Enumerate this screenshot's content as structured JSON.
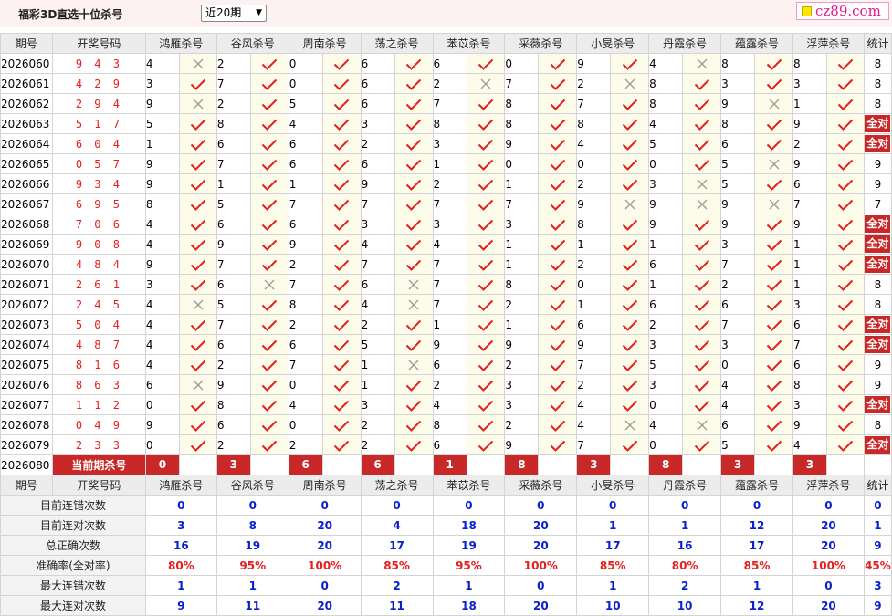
{
  "header": {
    "title": "福彩3D直选十位杀号",
    "range_selected": "近20期",
    "logo_text": "cz89.com"
  },
  "columns": {
    "issue": "期号",
    "code": "开奖号码",
    "experts": [
      "鸿雁杀号",
      "谷风杀号",
      "周南杀号",
      "荡之杀号",
      "苯苡杀号",
      "采薇杀号",
      "小旻杀号",
      "丹霞杀号",
      "蕴露杀号",
      "浮萍杀号"
    ],
    "stat": "统计"
  },
  "rows": [
    {
      "issue": "2026060",
      "code": "9 4 3",
      "kills": [
        4,
        2,
        0,
        6,
        6,
        0,
        9,
        4,
        8,
        8
      ],
      "hits": [
        0,
        1,
        1,
        1,
        1,
        1,
        1,
        0,
        1,
        1
      ],
      "stat": "8"
    },
    {
      "issue": "2026061",
      "code": "4 2 9",
      "kills": [
        3,
        7,
        0,
        6,
        2,
        7,
        2,
        8,
        3,
        3
      ],
      "hits": [
        1,
        1,
        1,
        1,
        0,
        1,
        0,
        1,
        1,
        1
      ],
      "stat": "8"
    },
    {
      "issue": "2026062",
      "code": "2 9 4",
      "kills": [
        9,
        2,
        5,
        6,
        7,
        8,
        7,
        8,
        9,
        1
      ],
      "hits": [
        0,
        1,
        1,
        1,
        1,
        1,
        1,
        1,
        0,
        1
      ],
      "stat": "8"
    },
    {
      "issue": "2026063",
      "code": "5 1 7",
      "kills": [
        5,
        8,
        4,
        3,
        8,
        8,
        8,
        4,
        8,
        9
      ],
      "hits": [
        1,
        1,
        1,
        1,
        1,
        1,
        1,
        1,
        1,
        1
      ],
      "stat": "全对"
    },
    {
      "issue": "2026064",
      "code": "6 0 4",
      "kills": [
        1,
        6,
        6,
        2,
        3,
        9,
        4,
        5,
        6,
        2
      ],
      "hits": [
        1,
        1,
        1,
        1,
        1,
        1,
        1,
        1,
        1,
        1
      ],
      "stat": "全对"
    },
    {
      "issue": "2026065",
      "code": "0 5 7",
      "kills": [
        9,
        7,
        6,
        6,
        1,
        0,
        0,
        0,
        5,
        9
      ],
      "hits": [
        1,
        1,
        1,
        1,
        1,
        1,
        1,
        1,
        0,
        1
      ],
      "stat": "9"
    },
    {
      "issue": "2026066",
      "code": "9 3 4",
      "kills": [
        9,
        1,
        1,
        9,
        2,
        1,
        2,
        3,
        5,
        6
      ],
      "hits": [
        1,
        1,
        1,
        1,
        1,
        1,
        1,
        0,
        1,
        1
      ],
      "stat": "9"
    },
    {
      "issue": "2026067",
      "code": "6 9 5",
      "kills": [
        8,
        5,
        7,
        7,
        7,
        7,
        9,
        9,
        9,
        7
      ],
      "hits": [
        1,
        1,
        1,
        1,
        1,
        1,
        0,
        0,
        0,
        1
      ],
      "stat": "7"
    },
    {
      "issue": "2026068",
      "code": "7 0 6",
      "kills": [
        4,
        6,
        6,
        3,
        3,
        3,
        8,
        9,
        9,
        9
      ],
      "hits": [
        1,
        1,
        1,
        1,
        1,
        1,
        1,
        1,
        1,
        1
      ],
      "stat": "全对"
    },
    {
      "issue": "2026069",
      "code": "9 0 8",
      "kills": [
        4,
        9,
        9,
        4,
        4,
        1,
        1,
        1,
        3,
        1
      ],
      "hits": [
        1,
        1,
        1,
        1,
        1,
        1,
        1,
        1,
        1,
        1
      ],
      "stat": "全对"
    },
    {
      "issue": "2026070",
      "code": "4 8 4",
      "kills": [
        9,
        7,
        2,
        7,
        7,
        1,
        2,
        6,
        7,
        1
      ],
      "hits": [
        1,
        1,
        1,
        1,
        1,
        1,
        1,
        1,
        1,
        1
      ],
      "stat": "全对"
    },
    {
      "issue": "2026071",
      "code": "2 6 1",
      "kills": [
        3,
        6,
        7,
        6,
        7,
        8,
        0,
        1,
        2,
        1
      ],
      "hits": [
        1,
        0,
        1,
        0,
        1,
        1,
        1,
        1,
        1,
        1
      ],
      "stat": "8"
    },
    {
      "issue": "2026072",
      "code": "2 4 5",
      "kills": [
        4,
        5,
        8,
        4,
        7,
        2,
        1,
        6,
        6,
        3
      ],
      "hits": [
        0,
        1,
        1,
        0,
        1,
        1,
        1,
        1,
        1,
        1
      ],
      "stat": "8"
    },
    {
      "issue": "2026073",
      "code": "5 0 4",
      "kills": [
        4,
        7,
        2,
        2,
        1,
        1,
        6,
        2,
        7,
        6
      ],
      "hits": [
        1,
        1,
        1,
        1,
        1,
        1,
        1,
        1,
        1,
        1
      ],
      "stat": "全对"
    },
    {
      "issue": "2026074",
      "code": "4 8 7",
      "kills": [
        4,
        6,
        6,
        5,
        9,
        9,
        9,
        3,
        3,
        7
      ],
      "hits": [
        1,
        1,
        1,
        1,
        1,
        1,
        1,
        1,
        1,
        1
      ],
      "stat": "全对"
    },
    {
      "issue": "2026075",
      "code": "8 1 6",
      "kills": [
        4,
        2,
        7,
        1,
        6,
        2,
        7,
        5,
        0,
        6
      ],
      "hits": [
        1,
        1,
        1,
        0,
        1,
        1,
        1,
        1,
        1,
        1
      ],
      "stat": "9"
    },
    {
      "issue": "2026076",
      "code": "8 6 3",
      "kills": [
        6,
        9,
        0,
        1,
        2,
        3,
        2,
        3,
        4,
        8
      ],
      "hits": [
        0,
        1,
        1,
        1,
        1,
        1,
        1,
        1,
        1,
        1
      ],
      "stat": "9"
    },
    {
      "issue": "2026077",
      "code": "1 1 2",
      "kills": [
        0,
        8,
        4,
        3,
        4,
        3,
        4,
        0,
        4,
        3
      ],
      "hits": [
        1,
        1,
        1,
        1,
        1,
        1,
        1,
        1,
        1,
        1
      ],
      "stat": "全对"
    },
    {
      "issue": "2026078",
      "code": "0 4 9",
      "kills": [
        9,
        6,
        0,
        2,
        8,
        2,
        4,
        4,
        6,
        9
      ],
      "hits": [
        1,
        1,
        1,
        1,
        1,
        1,
        0,
        0,
        1,
        1
      ],
      "stat": "8"
    },
    {
      "issue": "2026079",
      "code": "2 3 3",
      "kills": [
        0,
        2,
        2,
        2,
        6,
        9,
        7,
        0,
        5,
        4
      ],
      "hits": [
        1,
        1,
        1,
        1,
        1,
        1,
        1,
        1,
        1,
        1
      ],
      "stat": "全对"
    }
  ],
  "current": {
    "issue": "2026080",
    "label": "当前期杀号",
    "kills": [
      0,
      3,
      6,
      6,
      1,
      8,
      3,
      8,
      3,
      3
    ]
  },
  "summary": [
    {
      "label": "目前连错次数",
      "values": [
        "0",
        "0",
        "0",
        "0",
        "0",
        "0",
        "0",
        "0",
        "0",
        "0"
      ],
      "stat": "0",
      "red": false
    },
    {
      "label": "目前连对次数",
      "values": [
        "3",
        "8",
        "20",
        "4",
        "18",
        "20",
        "1",
        "1",
        "12",
        "20"
      ],
      "stat": "1",
      "red": false
    },
    {
      "label": "总正确次数",
      "values": [
        "16",
        "19",
        "20",
        "17",
        "19",
        "20",
        "17",
        "16",
        "17",
        "20"
      ],
      "stat": "9",
      "red": false
    },
    {
      "label": "准确率(全对率)",
      "values": [
        "80%",
        "95%",
        "100%",
        "85%",
        "95%",
        "100%",
        "85%",
        "80%",
        "85%",
        "100%"
      ],
      "stat": "45%",
      "red": true
    },
    {
      "label": "最大连错次数",
      "values": [
        "1",
        "1",
        "0",
        "2",
        "1",
        "0",
        "1",
        "2",
        "1",
        "0"
      ],
      "stat": "3",
      "red": false
    },
    {
      "label": "最大连对次数",
      "values": [
        "9",
        "11",
        "20",
        "11",
        "18",
        "20",
        "10",
        "10",
        "12",
        "20"
      ],
      "stat": "9",
      "red": false
    }
  ]
}
